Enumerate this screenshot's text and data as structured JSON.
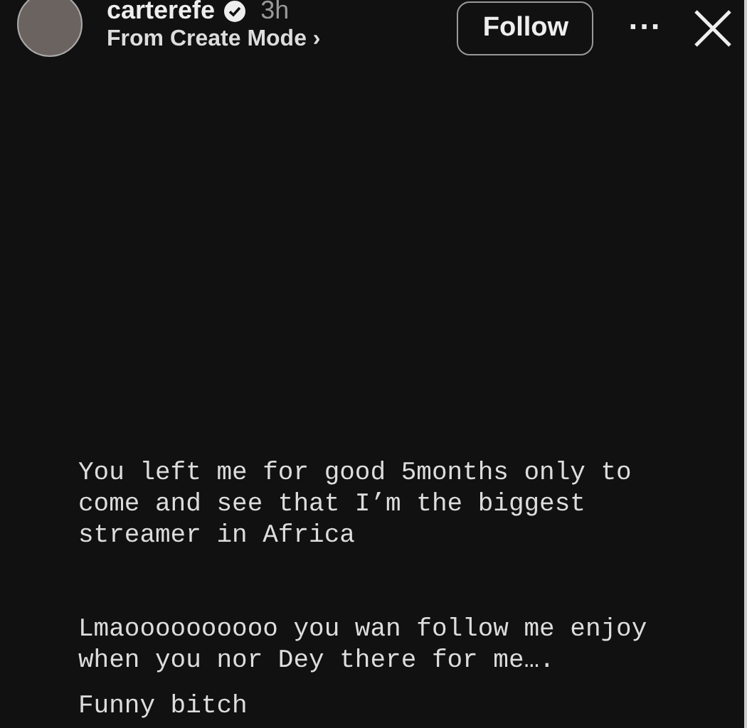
{
  "header": {
    "username": "carterefe",
    "verified": true,
    "time": "3h",
    "subtitle": "From Create Mode",
    "subtitle_chevron": "›",
    "follow_button": "Follow",
    "more_button": "···"
  },
  "story_text": [
    {
      "text": "You left me for good 5months only to come and see that I’m the biggest streamer in Africa"
    },
    {
      "text": "Lmaoooooooooo you wan follow me enjoy when you nor Dey there for me…."
    },
    {
      "text": "Funny bitch"
    }
  ]
}
